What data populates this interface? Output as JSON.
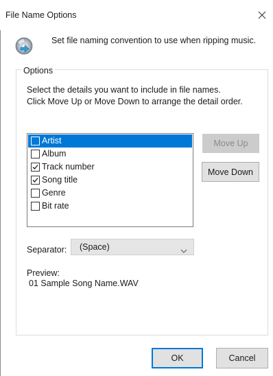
{
  "window": {
    "title": "File Name Options"
  },
  "header": {
    "text": "Set file naming convention to use when ripping music."
  },
  "options": {
    "group_label": "Options",
    "instructions": [
      "Select the details you want to include in file names.",
      "Click Move Up or Move Down to arrange the detail order."
    ],
    "items": [
      {
        "label": "Artist",
        "checked": false,
        "selected": true
      },
      {
        "label": "Album",
        "checked": false,
        "selected": false
      },
      {
        "label": "Track number",
        "checked": true,
        "selected": false
      },
      {
        "label": "Song title",
        "checked": true,
        "selected": false
      },
      {
        "label": "Genre",
        "checked": false,
        "selected": false
      },
      {
        "label": "Bit rate",
        "checked": false,
        "selected": false
      }
    ],
    "move_up_label": "Move Up",
    "move_up_enabled": false,
    "move_down_label": "Move Down",
    "separator_label": "Separator:",
    "separator_value": "(Space)",
    "preview_label": "Preview:",
    "preview_value": "01 Sample Song Name.WAV"
  },
  "footer": {
    "ok_label": "OK",
    "cancel_label": "Cancel"
  },
  "colors": {
    "accent": "#0078d7",
    "button_face": "#e1e1e1",
    "button_disabled": "#cccccc",
    "select_face": "#e5e5e5"
  },
  "icons": {
    "close": "close-icon",
    "header": "cd-rip-icon",
    "dropdown": "chevron-down-icon",
    "checkbox_check": "checkmark-icon"
  }
}
